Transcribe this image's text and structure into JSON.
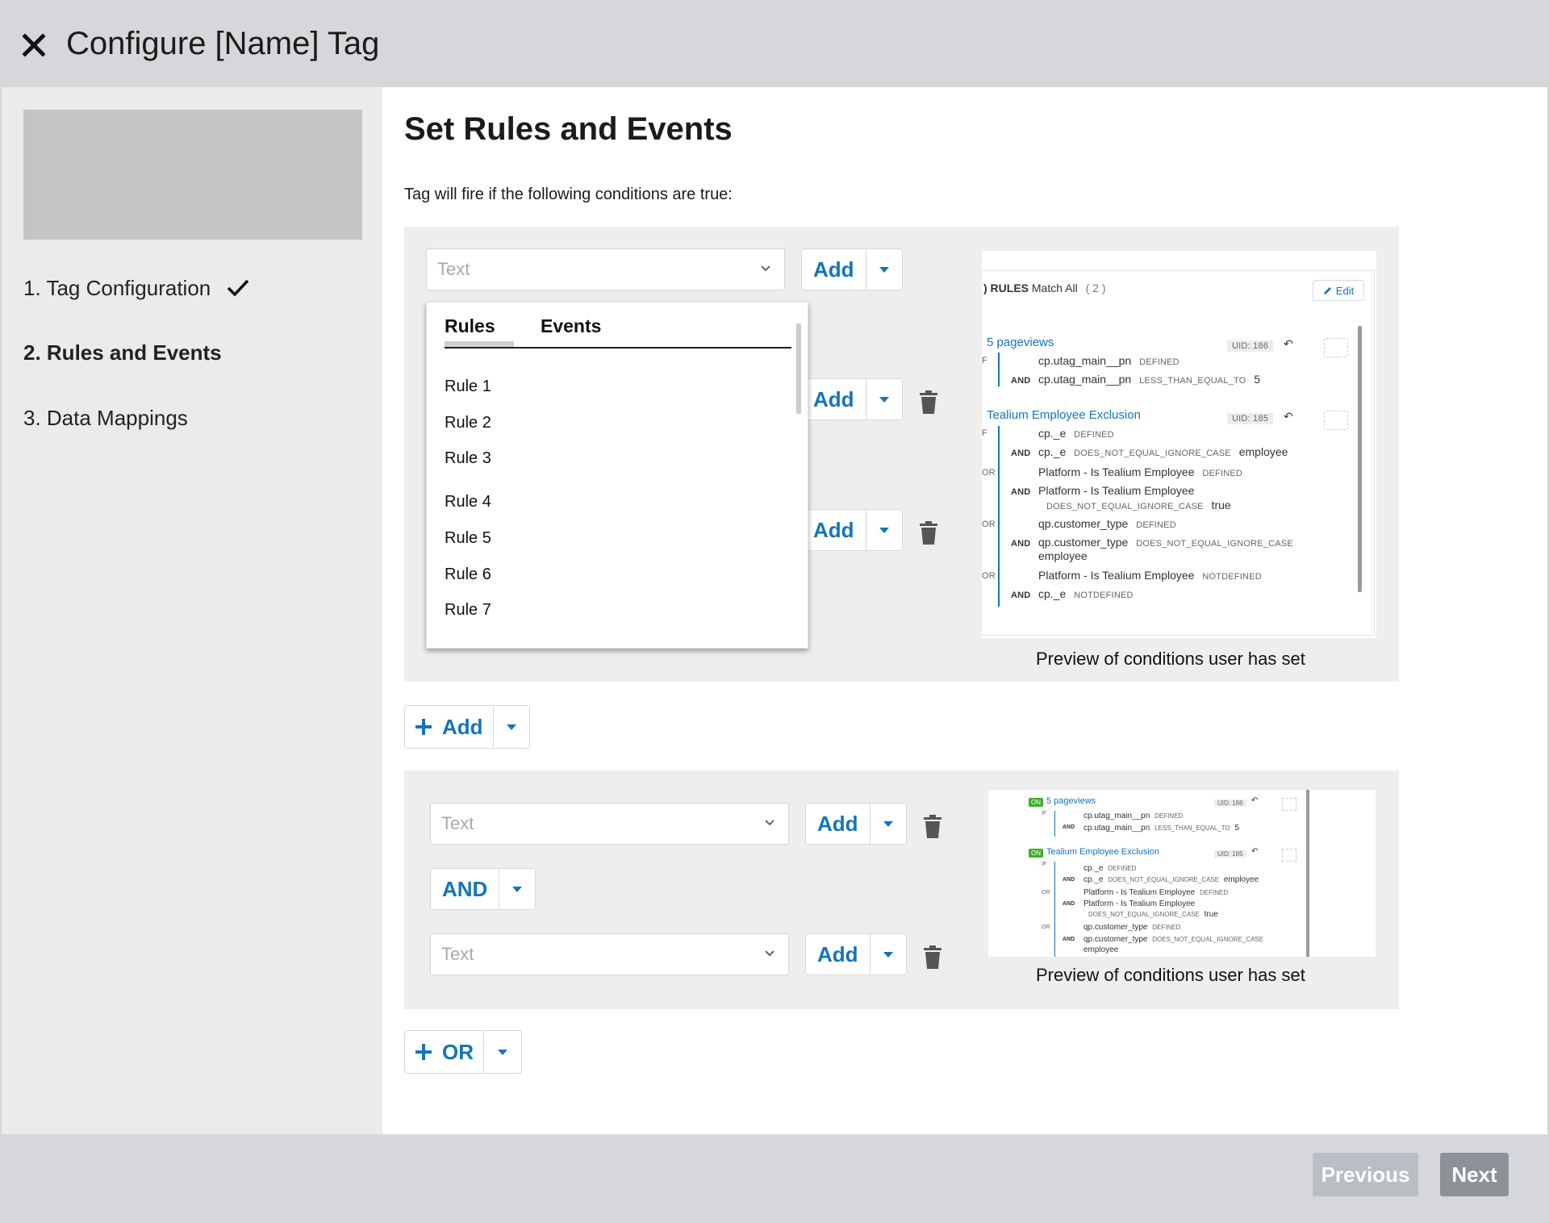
{
  "header": {
    "title": "Configure [Name] Tag"
  },
  "sidebar": {
    "steps": [
      {
        "label": "1. Tag Configuration"
      },
      {
        "label": "2. Rules and Events"
      },
      {
        "label": "3. Data Mappings"
      }
    ]
  },
  "main": {
    "title": "Set Rules and Events",
    "subtitle": "Tag will fire if the following conditions are true:"
  },
  "group1": {
    "dropdown_placeholder": "Text",
    "add_label": "Add",
    "popup": {
      "tabs": [
        "Rules",
        "Events"
      ],
      "rules": [
        "Rule 1",
        "Rule 2",
        "Rule 3",
        "Rule 4",
        "Rule 5",
        "Rule 6",
        "Rule 7"
      ]
    },
    "preview": {
      "caption": "Preview of conditions user has set",
      "header_rules": ") RULES",
      "header_match": "Match All",
      "header_count": "( 2 )",
      "edit": "Edit",
      "b1_title": "5 pageviews",
      "b1_uid": "UID: 186",
      "b1_r1a": "cp.utag_main__pn",
      "b1_r1b": "DEFINED",
      "b1_r2a": "cp.utag_main__pn",
      "b1_r2b": "LESS_THAN_EQUAL_TO",
      "b1_r2c": "5",
      "b2_title": "Tealium Employee Exclusion",
      "b2_uid": "UID: 185",
      "b2_r1a": "cp._e",
      "b2_r1b": "DEFINED",
      "b2_r2a": "cp._e",
      "b2_r2b": "DOES_NOT_EQUAL_IGNORE_CASE",
      "b2_r2c": "employee",
      "b2_r3a": "Platform - Is Tealium Employee",
      "b2_r3b": "DEFINED",
      "b2_r4a": "Platform - Is Tealium Employee",
      "b2_r4b": "DOES_NOT_EQUAL_IGNORE_CASE",
      "b2_r4c": "true",
      "b2_r5a": "qp.customer_type",
      "b2_r5b": "DEFINED",
      "b2_r6a": "qp.customer_type",
      "b2_r6b": "DOES_NOT_EQUAL_IGNORE_CASE",
      "b2_r6c": "employee",
      "b2_r7a": "Platform - Is Tealium Employee",
      "b2_r7b": "NOTDEFINED",
      "b2_r8a": "cp._e",
      "b2_r8b": "NOTDEFINED",
      "and": "AND",
      "or": "OR",
      "if": "F"
    }
  },
  "add_group_button": {
    "label": "Add"
  },
  "group2": {
    "dropdown1_placeholder": "Text",
    "dropdown2_placeholder": "Text",
    "add_label": "Add",
    "and_label": "AND",
    "preview": {
      "caption": "Preview of conditions user has set",
      "on": "ON",
      "b1_title": "5 pageviews",
      "b1_uid": "UID: 186",
      "if": "IF",
      "b1_r1a": "cp.utag_main__pn",
      "b1_r1b": "DEFINED",
      "b1_r2a": "cp.utag_main__pn",
      "b1_r2b": "LESS_THAN_EQUAL_TO",
      "b1_r2c": "5",
      "b2_title": "Tealium Employee Exclusion",
      "b2_uid": "UID: 185",
      "b2_r1a": "cp._e",
      "b2_r1b": "DEFINED",
      "b2_r2a": "cp._e",
      "b2_r2b": "DOES_NOT_EQUAL_IGNORE_CASE",
      "b2_r2c": "employee",
      "b2_r3a": "Platform - Is Tealium Employee",
      "b2_r3b": "DEFINED",
      "b2_r4a": "Platform - Is Tealium Employee",
      "b2_r4b": "DOES_NOT_EQUAL_IGNORE_CASE",
      "b2_r4c": "true",
      "b2_r5a": "qp.customer_type",
      "b2_r5b": "DEFINED",
      "b2_r6a": "qp.customer_type",
      "b2_r6b": "DOES_NOT_EQUAL_IGNORE_CASE",
      "b2_r6c": "employee",
      "and": "AND",
      "or": "OR"
    }
  },
  "or_button": {
    "label": "OR"
  },
  "footer": {
    "previous": "Previous",
    "next": "Next"
  },
  "colors": {
    "accent": "#1475b7",
    "on_badge": "#3fae29",
    "next_button": "#8b9298",
    "previous_button": "#b7bec4"
  }
}
